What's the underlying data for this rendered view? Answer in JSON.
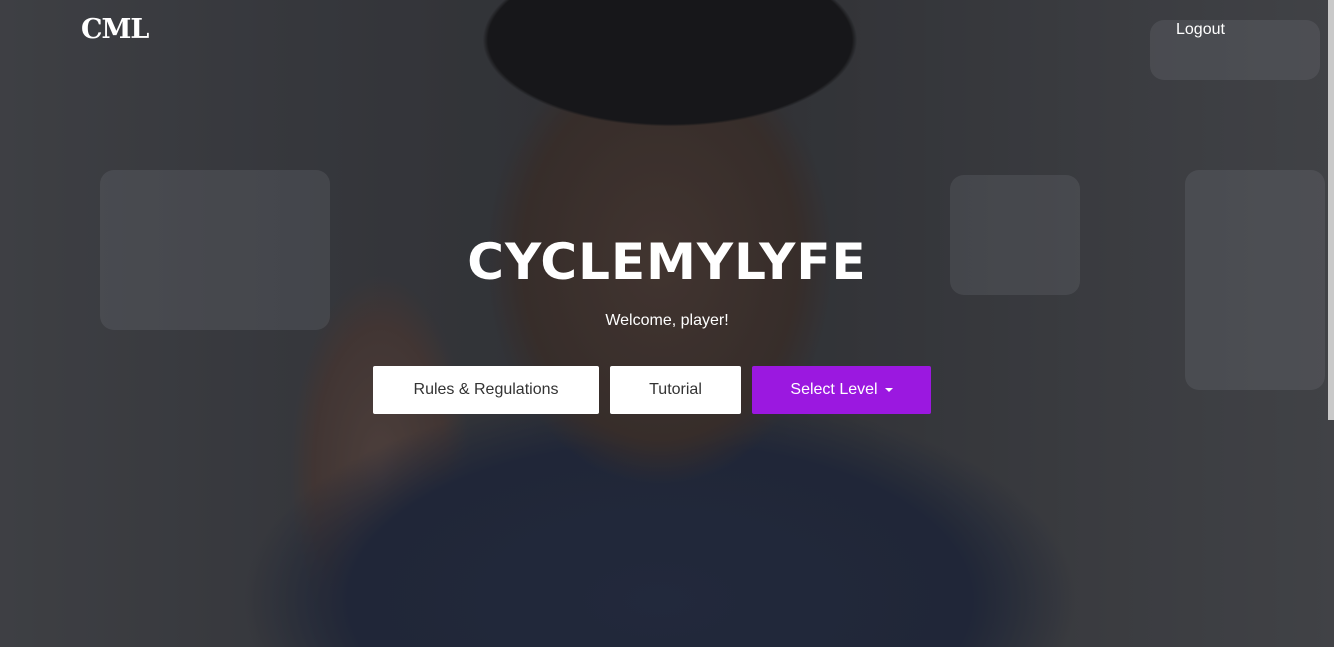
{
  "navbar": {
    "brand": "CML",
    "logout_label": "Logout"
  },
  "hero": {
    "title": "CYCLEMYLYFE",
    "subtitle": "Welcome, player!"
  },
  "actions": {
    "rules_label": "Rules & Regulations",
    "tutorial_label": "Tutorial",
    "select_level_label": "Select Level"
  },
  "icons": {
    "select_level_caret": "caret-down-icon"
  },
  "colors": {
    "accent": "#9b18e0",
    "button_light": "#ffffff",
    "text_light": "#ffffff"
  }
}
